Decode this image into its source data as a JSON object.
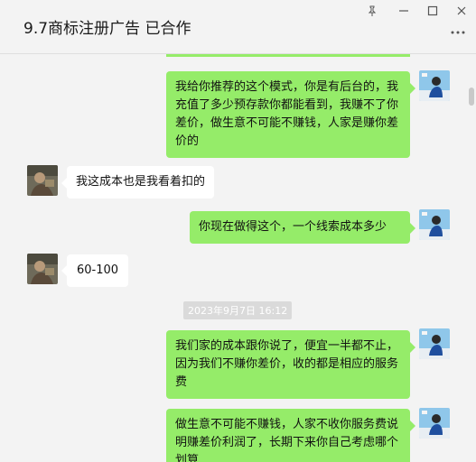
{
  "window": {
    "title": "9.7商标注册广告 已合作",
    "pin_icon": "pin-icon",
    "minimize_icon": "minimize-icon",
    "maximize_icon": "maximize-icon",
    "close_icon": "close-icon",
    "more_icon": "more-dots-icon"
  },
  "colors": {
    "my_bubble": "#95ec69",
    "other_bubble": "#ffffff",
    "background": "#f3f3f3"
  },
  "messages": [
    {
      "from": "me",
      "text": "我给你推荐的这个模式，你是有后台的，我充值了多少预存款你都能看到，我赚不了你差价，做生意不可能不赚钱，人家是赚你差价的"
    },
    {
      "from": "other",
      "text": "我这成本也是我看着扣的"
    },
    {
      "from": "me",
      "text": "你现在做得这个，一个线索成本多少"
    },
    {
      "from": "other",
      "text": "60-100"
    },
    {
      "from": "me",
      "text": "我们家的成本跟你说了，便宜一半都不止，因为我们不赚你差价，收的都是相应的服务费"
    },
    {
      "from": "me",
      "text": "做生意不可能不赚钱，人家不收你服务费说明赚差价利润了，长期下来你自己考虑哪个划算"
    }
  ],
  "timestamp": "2023年9月7日 16:12"
}
